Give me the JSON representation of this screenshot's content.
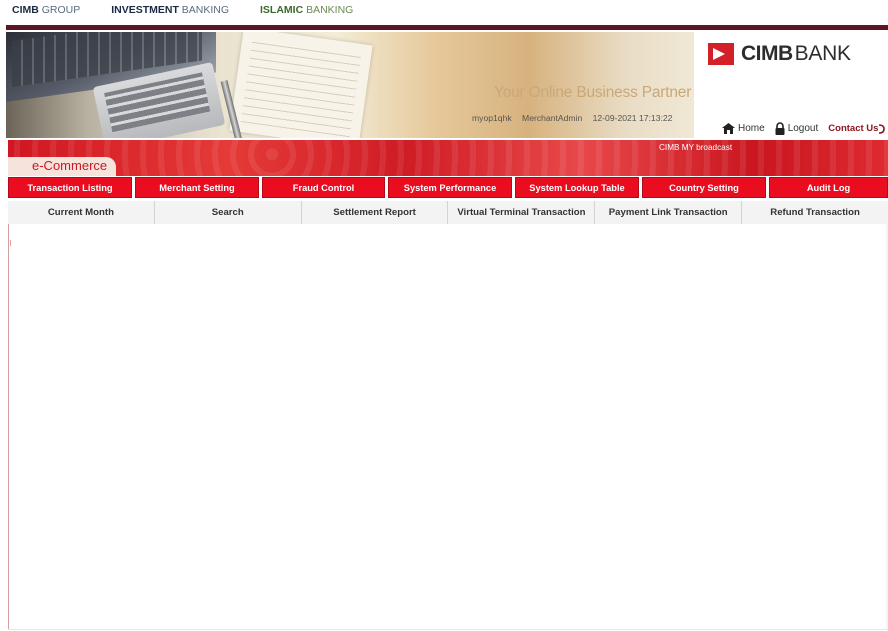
{
  "group_nav": {
    "cimb_bold": "CIMB",
    "cimb_light": "GROUP",
    "ib_bold": "INVESTMENT",
    "ib_light": "BANKING",
    "islamic_bold": "ISLAMIC",
    "islamic_light": "BANKING"
  },
  "header": {
    "tagline": "Your Online Business Partner",
    "username": "myop1qhk",
    "role": "MerchantAdmin",
    "datetime": "12-09-2021 17:13:22",
    "logo_cimb": "CIMB",
    "logo_bank": "BANK",
    "links": {
      "home": "Home",
      "logout": "Logout",
      "contact": "Contact Us"
    }
  },
  "section_tab": "e-Commerce",
  "broadcast": "CIMB MY broadcast",
  "main_menu": [
    "Transaction Listing",
    "Merchant Setting",
    "Fraud Control",
    "System Performance",
    "System Lookup Table",
    "Country Setting",
    "Audit Log"
  ],
  "sub_menu": [
    "Current Month",
    "Search",
    "Settlement Report",
    "Virtual Terminal Transaction",
    "Payment Link Transaction",
    "Refund Transaction"
  ],
  "colors": {
    "brand_red": "#ea0c1f",
    "dark_maroon": "#5c1523",
    "tab_bg": "#f6e3dc"
  }
}
